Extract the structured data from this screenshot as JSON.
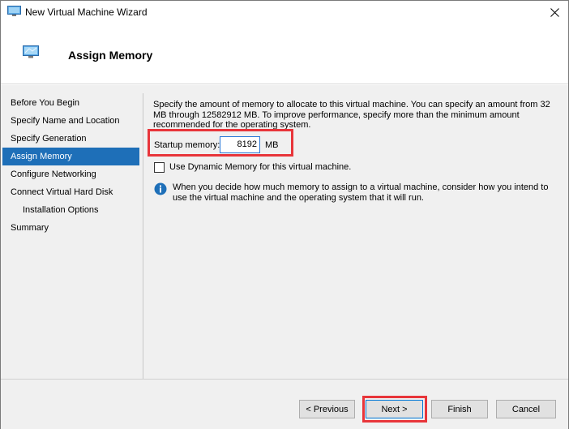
{
  "window": {
    "title": "New Virtual Machine Wizard",
    "close_glyph": "✕"
  },
  "header": {
    "title": "Assign Memory",
    "icon": "wizard-monitor-icon"
  },
  "nav": {
    "items": [
      {
        "label": "Before You Begin"
      },
      {
        "label": "Specify Name and Location"
      },
      {
        "label": "Specify Generation"
      },
      {
        "label": "Assign Memory"
      },
      {
        "label": "Configure Networking"
      },
      {
        "label": "Connect Virtual Hard Disk"
      },
      {
        "label": "Installation Options"
      },
      {
        "label": "Summary"
      }
    ],
    "active_index": 3
  },
  "main": {
    "description": "Specify the amount of memory to allocate to this virtual machine. You can specify an amount from 32 MB through 12582912 MB. To improve performance, specify more than the minimum amount recommended for the operating system.",
    "startup_memory_label": "Startup memory:",
    "startup_memory_value": "8192",
    "startup_memory_unit": "MB",
    "dynamic_memory_label": "Use Dynamic Memory for this virtual machine.",
    "dynamic_memory_checked": false,
    "info_text": "When you decide how much memory to assign to a virtual machine, consider how you intend to use the virtual machine and the operating system that it will run."
  },
  "footer": {
    "previous_label": "< Previous",
    "next_label": "Next >",
    "finish_label": "Finish",
    "cancel_label": "Cancel"
  },
  "colors": {
    "nav_active": "#1e6fb8",
    "highlight": "#e8353a",
    "info_icon": "#1e6fb8"
  }
}
